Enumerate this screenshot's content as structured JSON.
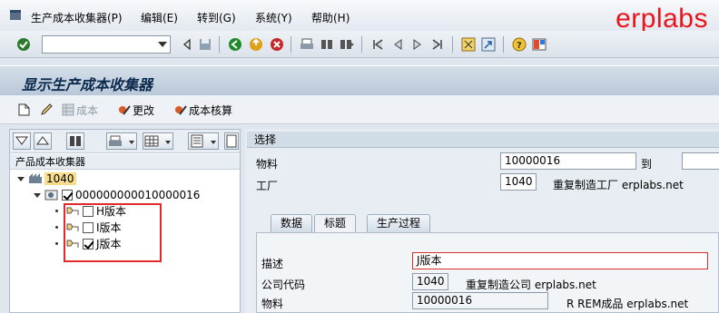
{
  "menu": {
    "items": [
      "生产成本收集器(P)",
      "编辑(E)",
      "转到(G)",
      "系统(Y)",
      "帮助(H)"
    ]
  },
  "brand": "erplabs",
  "title": "显示生产成本收集器",
  "app_toolbar": {
    "cost_label": "成本",
    "change_label": "更改",
    "accounting_label": "成本核算"
  },
  "tree": {
    "header": "产品成本收集器",
    "plant_node": "1040",
    "material_node": "000000000010000016",
    "versions": [
      {
        "label": "H版本",
        "checked": false
      },
      {
        "label": "I版本",
        "checked": false
      },
      {
        "label": "J版本",
        "checked": true
      }
    ]
  },
  "selection": {
    "header": "选择",
    "material_label": "物料",
    "material_value": "10000016",
    "to_label": "到",
    "plant_label": "工厂",
    "plant_value": "1040",
    "plant_desc": "重复制造工厂 erplabs.net"
  },
  "tabs": [
    "数据",
    "标题",
    "生产过程"
  ],
  "detail": {
    "desc_label": "描述",
    "desc_value": "J版本",
    "company_label": "公司代码",
    "company_value": "1040",
    "company_desc": "重复制造公司 erplabs.net",
    "material_label": "物料",
    "material_value": "10000016",
    "material_desc": "R REM成品 erplabs.net"
  },
  "colors": {
    "brand": "#e8141c",
    "highlight_box": "#e2292c",
    "selected_node": "#f7dc8c"
  }
}
